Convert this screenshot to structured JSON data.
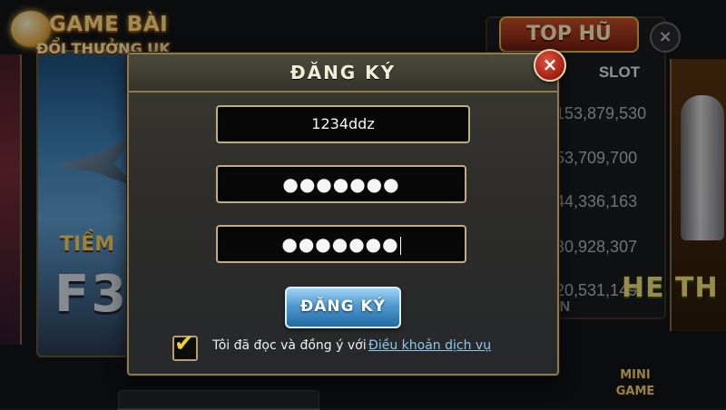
{
  "logo": {
    "line1": "GAME BÀI",
    "line2": "ĐỔI THƯỞNG UK"
  },
  "background": {
    "left_card": {
      "line1": "TIỀM",
      "line2": "F3"
    },
    "top_hu": {
      "title": "TOP HŨ",
      "close_icon": "×",
      "column_header": "SLOT",
      "jackpots": [
        "153,879,530",
        "53,709,700",
        "44,336,163",
        "30,928,307",
        "20,531,149"
      ],
      "footer_text": "EN"
    },
    "right_card_text": "HE TH",
    "mini_game": {
      "line1": "MINI",
      "line2": "GAME"
    }
  },
  "dialog": {
    "title": "ĐĂNG KÝ",
    "close_icon": "×",
    "username_value": "1234ddz",
    "password_value": "●●●●●●●",
    "confirm_password_value": "●●●●●●●",
    "register_button": "ĐĂNG KÝ",
    "terms": {
      "checked": true,
      "check_icon": "✔",
      "text": "Tôi đã đọc và đồng ý với",
      "link": "Điều khoản dịch vụ"
    }
  },
  "colors": {
    "dialog_border": "#8f7b4a",
    "input_border": "#c2ad80",
    "button_blue": "#4f99cf",
    "link": "#8ec7ee",
    "checkmark": "#f2d22e",
    "close_red": "#c0392b"
  }
}
